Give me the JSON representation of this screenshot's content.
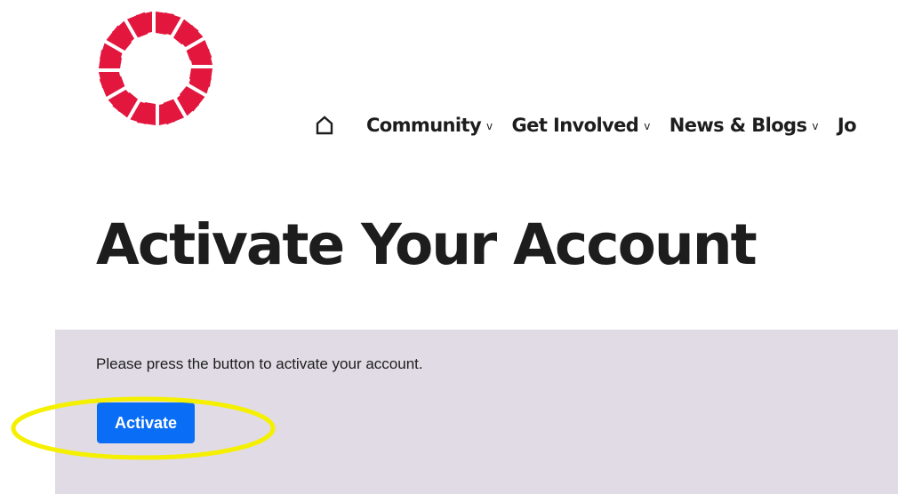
{
  "nav": {
    "home_icon": "home-icon",
    "items": [
      {
        "label": "Community",
        "chevron": "v"
      },
      {
        "label": "Get Involved",
        "chevron": "v"
      },
      {
        "label": "News & Blogs",
        "chevron": "v"
      },
      {
        "label": "Jo"
      }
    ]
  },
  "page": {
    "title": "Activate Your Account"
  },
  "panel": {
    "instruction": "Please press the button to activate your account.",
    "button_label": "Activate"
  },
  "colors": {
    "brand_red": "#e3163e",
    "button_blue": "#0a6df5",
    "panel_bg": "#e0dbe5",
    "highlight_yellow": "#f5f000"
  }
}
